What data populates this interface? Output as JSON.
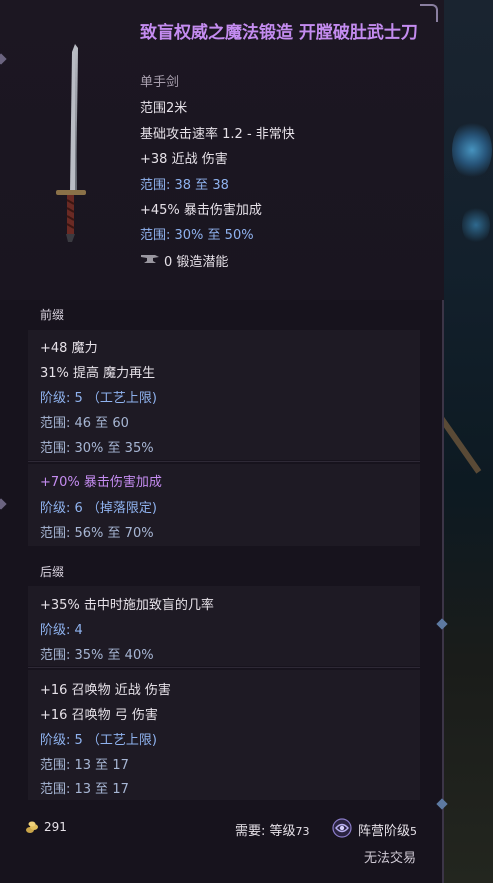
{
  "item": {
    "name": "致盲权威之魔法锻造 开膛破肚武士刀",
    "type": "单手剑",
    "icon": "katana-icon",
    "base": [
      {
        "text": "范围2米",
        "style": "w"
      },
      {
        "text": "基础攻击速率 1.2 - 非常快",
        "style": "w"
      },
      {
        "text": "+38 近战 伤害",
        "style": "w"
      },
      {
        "text": "范围: 38 至 38",
        "style": "b"
      },
      {
        "text": "+45% 暴击伤害加成",
        "style": "w"
      },
      {
        "text": "范围: 30% 至 50%",
        "style": "b"
      }
    ],
    "forge_potential": "0 锻造潜能"
  },
  "prefix": {
    "title": "前缀",
    "affixes": [
      {
        "lines": [
          {
            "text": "+48 魔力",
            "style": "w"
          },
          {
            "text": "31% 提高 魔力再生",
            "style": "w"
          },
          {
            "text": "阶级: 5 （工艺上限)",
            "style": "b"
          },
          {
            "text": "范围: 46 至 60",
            "style": "dim"
          },
          {
            "text": "范围: 30% 至 35%",
            "style": "dim"
          }
        ]
      },
      {
        "lines": [
          {
            "text": "+70% 暴击伤害加成",
            "style": "purple"
          },
          {
            "text": "阶级: 6 （掉落限定)",
            "style": "b"
          },
          {
            "text": "范围: 56% 至 70%",
            "style": "dim"
          }
        ]
      }
    ]
  },
  "suffix": {
    "title": "后缀",
    "affixes": [
      {
        "lines": [
          {
            "text": "+35% 击中时施加致盲的几率",
            "style": "w"
          },
          {
            "text": "阶级: 4",
            "style": "b"
          },
          {
            "text": "范围: 35% 至 40%",
            "style": "dim"
          }
        ]
      },
      {
        "lines": [
          {
            "text": "+16 召唤物 近战 伤害",
            "style": "w"
          },
          {
            "text": "+16 召唤物 弓 伤害",
            "style": "w"
          },
          {
            "text": "阶级: 5 （工艺上限)",
            "style": "b"
          },
          {
            "text": "范围: 13 至 17",
            "style": "dim"
          },
          {
            "text": "范围: 13 至 17",
            "style": "dim"
          }
        ]
      }
    ]
  },
  "footer": {
    "gold": "291",
    "require_label": "需要: 等级",
    "require_level": "73",
    "faction_label": "阵营阶级",
    "faction_level": "5",
    "trade": "无法交易"
  },
  "colors": {
    "name": "#c48cf0",
    "range": "#8fb2ee"
  }
}
